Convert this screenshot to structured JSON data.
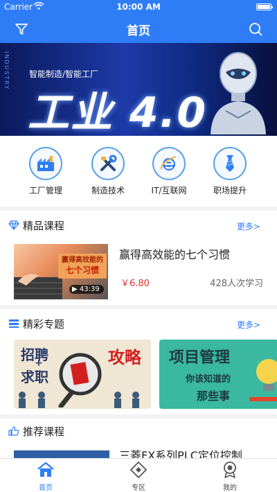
{
  "status_bar": {
    "carrier": "Carrier",
    "time": "10:00 AM"
  },
  "navbar": {
    "title": "首页",
    "left_icon": "filter-icon",
    "right_icon": "search-icon"
  },
  "banner": {
    "vertical_text": "INDUSTRY",
    "subtitle": "智能制造/智能工厂",
    "headline": "工业 4.0"
  },
  "categories": [
    {
      "label": "工厂管理",
      "icon": "factory-icon"
    },
    {
      "label": "制造技术",
      "icon": "tools-icon"
    },
    {
      "label": "IT/互联网",
      "icon": "ie-browser-icon"
    },
    {
      "label": "职场提升",
      "icon": "necktie-icon"
    }
  ],
  "featured_courses": {
    "title": "精品课程",
    "more": "更多>",
    "items": [
      {
        "thumb_text_1": "赢得高效能的",
        "thumb_text_2": "七个习惯",
        "duration": "43:39",
        "name": "赢得高效能的七个习惯",
        "price": "￥6.80",
        "learners": "428人次学习"
      }
    ]
  },
  "topics": {
    "title": "精彩专题",
    "more": "更多>",
    "cards": [
      {
        "text_a": "招聘",
        "text_b": "+",
        "text_c": "求职",
        "text_d": "攻略"
      },
      {
        "text_a": "项目管理",
        "text_b": "你该知道的",
        "text_c": "那些事"
      }
    ]
  },
  "recommended": {
    "title": "推荐课程",
    "items": [
      {
        "name": "三菱FX系列PLC定位控制"
      }
    ]
  },
  "tabbar": [
    {
      "label": "首页",
      "icon": "home-icon",
      "active": true
    },
    {
      "label": "专区",
      "icon": "diamond-zone-icon",
      "active": false
    },
    {
      "label": "我的",
      "icon": "profile-badge-icon",
      "active": false
    }
  ],
  "colors": {
    "primary": "#2f7df6",
    "price": "#e53030",
    "background": "#f2f2f2"
  }
}
